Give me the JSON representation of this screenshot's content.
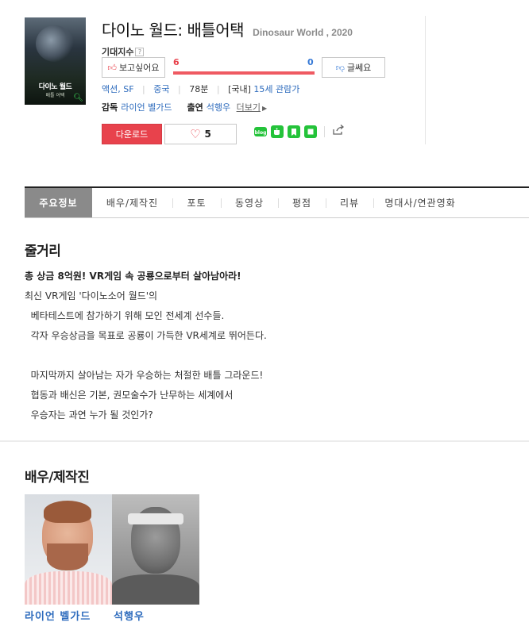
{
  "movie": {
    "title_ko": "다이노 월드: 배틀어택",
    "title_en": "Dinosaur World , 2020",
    "poster": {
      "title": "다이노 월드",
      "subtitle": "배틀 어택",
      "icon": "zoom-icon"
    }
  },
  "rating": {
    "expect_label": "기대지수",
    "help_mark": "?",
    "want_label": "보고싶어요",
    "dislike_label": "글쎄요",
    "want_count": "6",
    "dislike_count": "0",
    "want_ratio": 1.0,
    "colors": {
      "want": "#e8424c",
      "dislike": "#3478d6"
    }
  },
  "meta": {
    "genre": "액션, SF",
    "country": "중국",
    "runtime": "78분",
    "rating_prefix": "[국내]",
    "rating_value": "15세 관람가"
  },
  "credits": {
    "director_label": "감독",
    "director": "라이언 벨가드",
    "cast_label": "출연",
    "cast": "석행우",
    "more": "더보기"
  },
  "actions": {
    "download": "다운로드",
    "like_count": "5",
    "share_icons": [
      "blog-icon",
      "cafe-icon",
      "bookmark-icon",
      "note-icon",
      "share-icon"
    ],
    "accent": "#e8424c"
  },
  "tabs": [
    "주요정보",
    "배우/제작진",
    "포토",
    "동영상",
    "평점",
    "리뷰",
    "명대사/연관영화"
  ],
  "synopsis": {
    "title": "줄거리",
    "headline": "총 상금 8억원! VR게임 속 공룡으로부터 살아남아라!",
    "lines": [
      "최신 VR게임 '다이노소어 월드'의",
      "  베타테스트에 참가하기 위해 모인 전세계 선수들.",
      "  각자 우승상금을 목표로 공룡이 가득한 VR세계로 뛰어든다.",
      "",
      "  마지막까지 살아남는 자가 우승하는 처절한 배틀 그라운드!",
      "  협동과 배신은 기본, 권모술수가 난무하는 세계에서",
      "  우승자는 과연 누가 될 것인가?"
    ]
  },
  "cast_section": {
    "title": "배우/제작진",
    "people": [
      {
        "name": "라이언 벨가드"
      },
      {
        "name": "석행우"
      }
    ]
  }
}
